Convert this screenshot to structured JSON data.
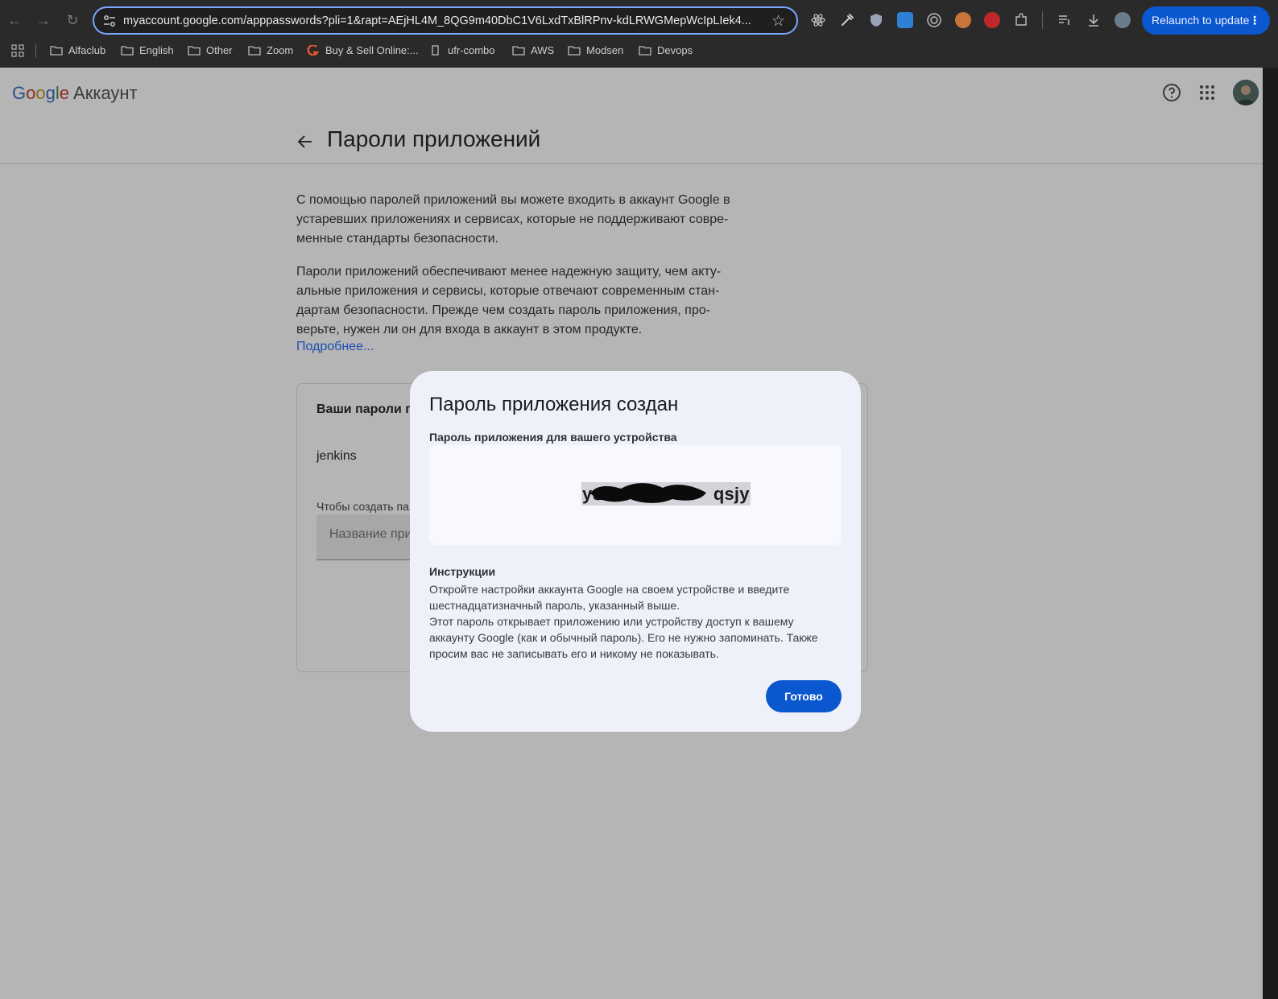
{
  "browser": {
    "url": "myaccount.google.com/apppasswords?pli=1&rapt=AEjHL4M_8QG9m40DbC1V6LxdTxBlRPnv-kdLRWGMepWcIpLIek4...",
    "relaunch_label": "Relaunch to update",
    "bookmarks": [
      "Alfaclub",
      "English",
      "Other",
      "Zoom",
      "Buy & Sell Online:...",
      "ufr-combo",
      "AWS",
      "Modsen",
      "Devops"
    ]
  },
  "header": {
    "logo_letters": [
      "G",
      "o",
      "o",
      "g",
      "l",
      "e"
    ],
    "product": "Аккаунт"
  },
  "page": {
    "title": "Пароли приложений",
    "intro_lines": [
      "С помощью паролей приложений вы можете входить в аккаунт Google в",
      "устаревших приложениях и сервисах, которые не поддерживают совре-",
      "менные стандарты безопасности."
    ],
    "warning_lines": [
      "Пароли приложений обеспечивают менее надежную защиту, чем акту-",
      "альные приложения и сервисы, которые отвечают современным стан-",
      "дартам безопасности. Прежде чем создать пароль приложения, про-",
      "верьте, нужен ли он для входа в аккаунт в этом продукте."
    ],
    "learn_more": "Подробнее...",
    "card": {
      "title": "Ваши пароли п",
      "item": "jenkins",
      "hint": "Чтобы создать па",
      "input_placeholder": "Название при"
    }
  },
  "dialog": {
    "title": "Пароль приложения создан",
    "label": "Пароль приложения для вашего устройства",
    "password_visible": "yu           qsjy",
    "instructions_heading": "Инструкции",
    "instructions_lines": [
      "Откройте настройки аккаунта Google на своем устройстве и введите",
      "шестнадцатизначный пароль, указанный выше.",
      "Этот пароль открывает приложению или устройству доступ к вашему",
      "аккаунту Google (как и обычный пароль). Его не нужно запоминать. Также",
      "просим вас не записывать его и никому не показывать."
    ],
    "done_label": "Готово"
  }
}
